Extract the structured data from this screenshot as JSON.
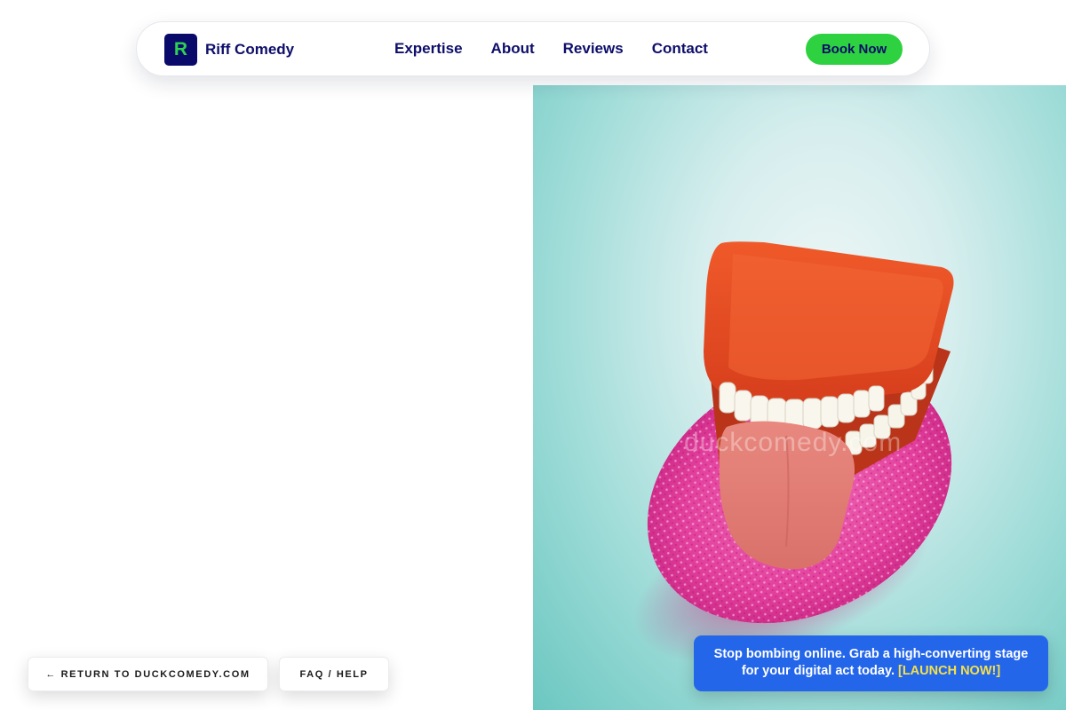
{
  "nav": {
    "brand": {
      "logo_letter": "R",
      "name": "Riff Comedy"
    },
    "links": [
      {
        "label": "Expertise"
      },
      {
        "label": "About"
      },
      {
        "label": "Reviews"
      },
      {
        "label": "Contact"
      }
    ],
    "cta_label": "Book Now"
  },
  "hero_image": {
    "watermark": "duckcomedy.com"
  },
  "footer_buttons": {
    "return_label": "← RETURN TO DUCKCOMEDY.COM",
    "faq_label": "FAQ / HELP"
  },
  "promo": {
    "text": "Stop bombing online. Grab a high-converting stage for your digital act today.",
    "cta": "[LAUNCH NOW!]"
  },
  "colors": {
    "navy": "#0e0e6b",
    "brand_green": "#2ed13f",
    "promo_blue": "#2466ea",
    "promo_cta_yellow": "#f5e14a"
  }
}
